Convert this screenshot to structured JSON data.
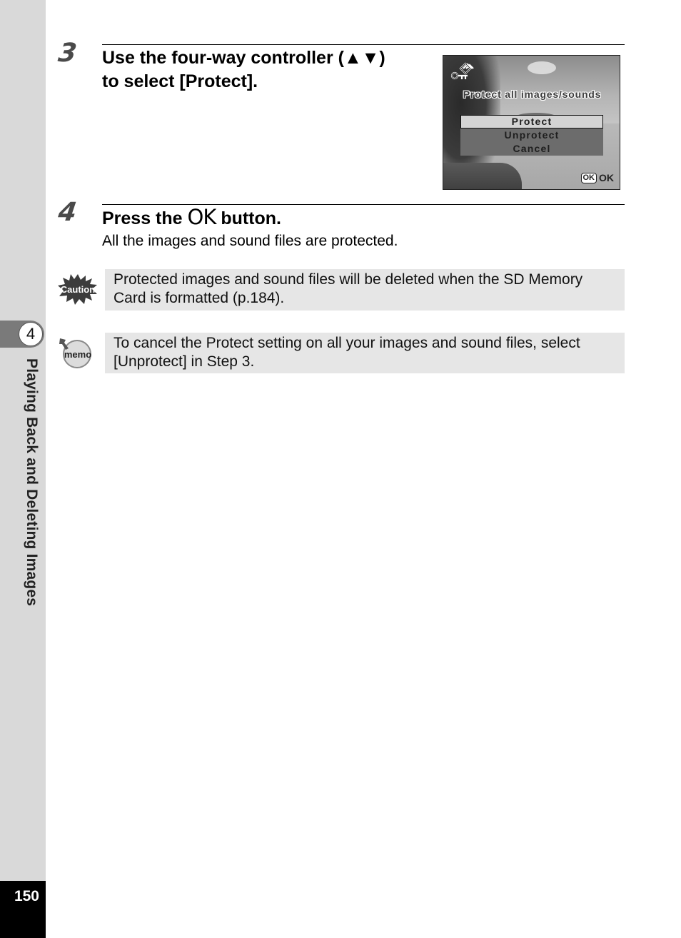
{
  "sidebar": {
    "chapter_number": "4",
    "chapter_title": "Playing Back and Deleting Images",
    "page_number": "150"
  },
  "steps": [
    {
      "number": "3",
      "title_line1": "Use the four-way controller (▲▼)",
      "title_line2": "to select [Protect].",
      "screen": {
        "icon": "protect-key-icon",
        "title": "Protect all images/sounds",
        "menu": [
          "Protect",
          "Unprotect",
          "Cancel"
        ],
        "selected_index": 0,
        "ok_key": "OK",
        "ok_label": "OK"
      }
    },
    {
      "number": "4",
      "title_prefix": "Press the",
      "title_ok": "OK",
      "title_suffix": "button.",
      "body": "All the images and sound files are protected."
    }
  ],
  "notes": [
    {
      "type": "caution",
      "icon_label": "Caution",
      "text": "Protected images and sound files will be deleted when the SD Memory Card is formatted (p.184)."
    },
    {
      "type": "memo",
      "icon_label": "memo",
      "text": "To cancel the Protect setting on all your images and sound files, select [Unprotect] in Step 3."
    }
  ]
}
